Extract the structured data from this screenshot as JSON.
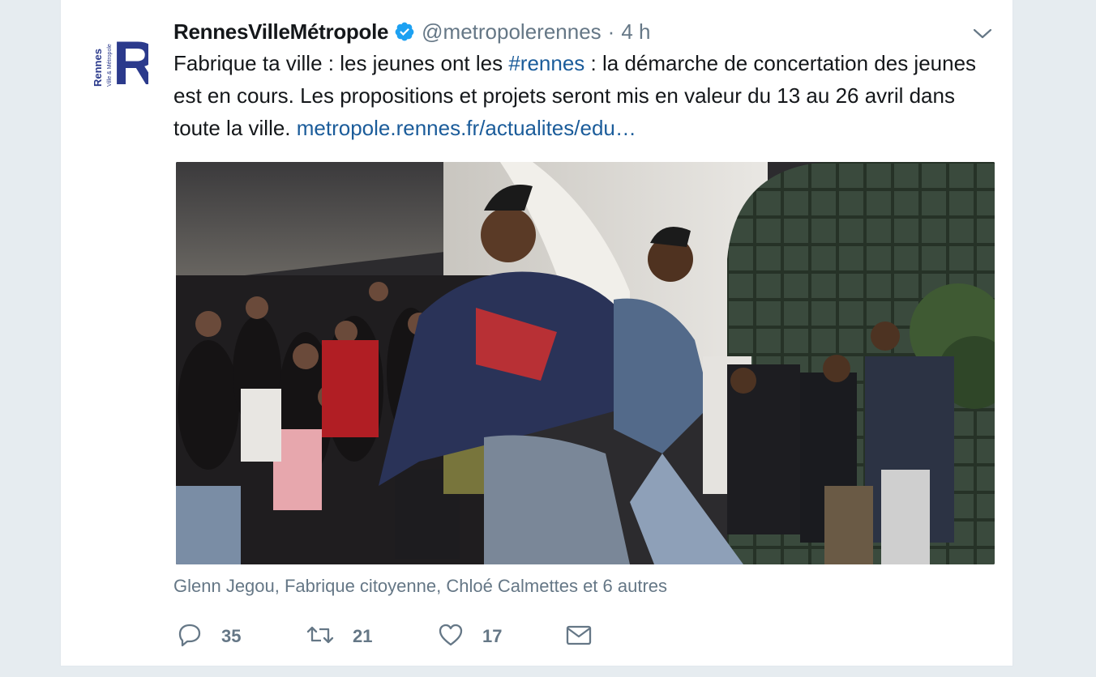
{
  "tweet": {
    "display_name": "RennesVilleMétropole",
    "verified_icon": "verified-badge-icon",
    "handle": "@metropolerennes",
    "separator": "·",
    "time": "4 h",
    "text_before_hashtag": "Fabrique ta ville : les jeunes ont les ",
    "hashtag": "#rennes",
    "text_after_hashtag": " : la démarche de concertation des jeunes est en cours. Les propositions et projets seront mis en valeur du 13 au 26 avril dans toute la ville. ",
    "link": "metropole.rennes.fr/actualites/edu…",
    "tagged_people": "Glenn Jegou, Fabrique citoyenne, Chloé Calmettes et 6 autres"
  },
  "avatar": {
    "logo_text": "Rennes",
    "logo_subtext": "Ville & Métropole",
    "logo_letter": "R"
  },
  "actions": {
    "reply_count": "35",
    "retweet_count": "21",
    "like_count": "17"
  },
  "colors": {
    "link": "#1b5c9a",
    "secondary_text": "#657786",
    "verified": "#1da1f2",
    "background": "#e6ecf0",
    "logo": "#2b3a8c"
  }
}
